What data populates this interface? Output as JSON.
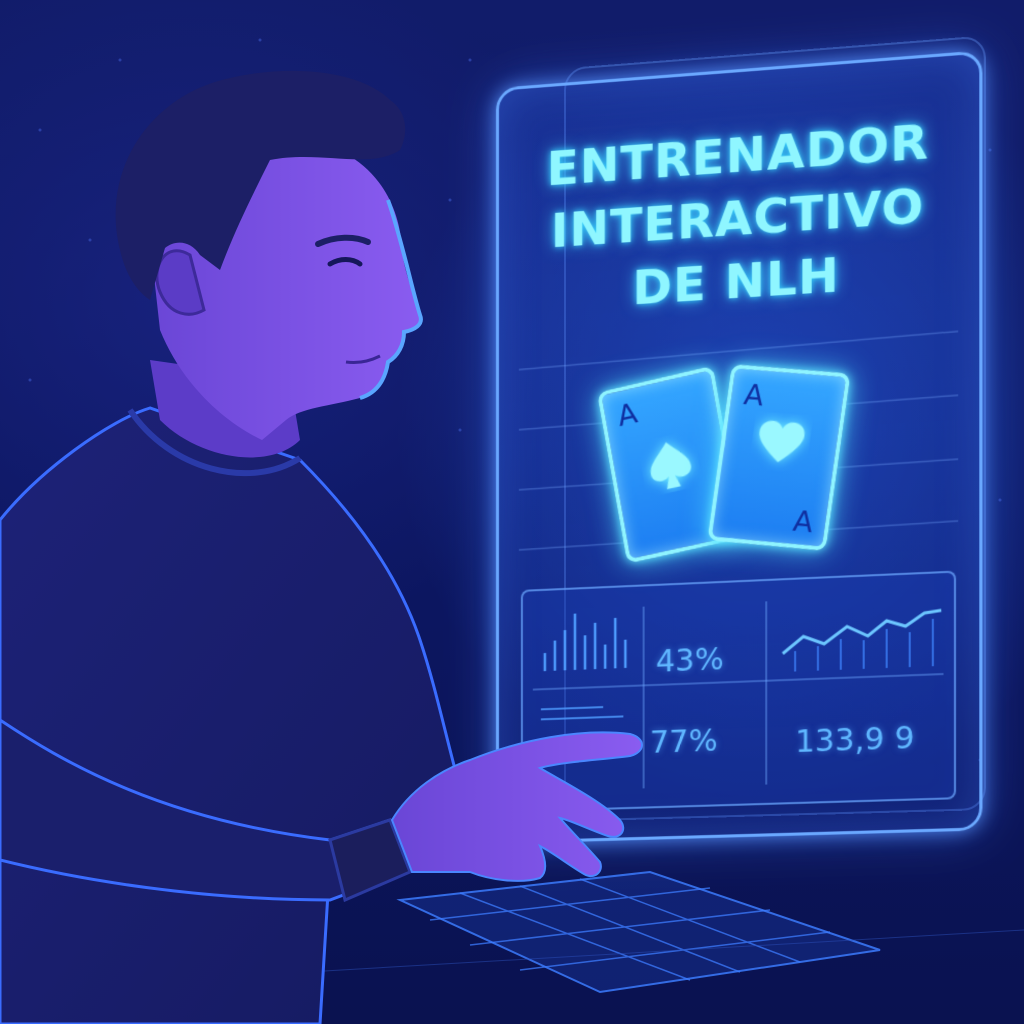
{
  "panel": {
    "title_lines": [
      "ENTRENADOR",
      "INTERACTIVO",
      "DE NLH"
    ]
  },
  "cards": [
    {
      "rank": "A",
      "suit": "spade-icon"
    },
    {
      "rank": "A",
      "suit": "heart-icon"
    }
  ],
  "stats": {
    "stat_1": "43%",
    "stat_2": "77%",
    "stat_3": "133,9 9"
  },
  "colors": {
    "background": "#0c1660",
    "glow": "#8ff6ff",
    "panel_border": "#6aa8ff",
    "skin": "#7a4fe0",
    "shirt": "#1b1f6e"
  }
}
